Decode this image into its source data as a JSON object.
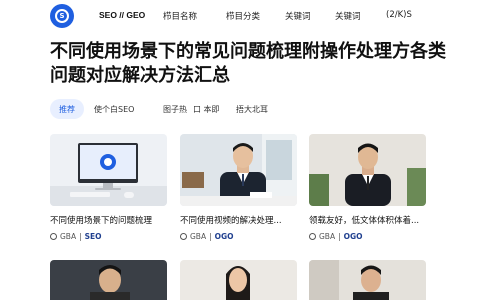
{
  "header": {
    "brand": "SEO // GEO",
    "nav": [
      "栉目名称",
      "栉目分类",
      "关键词",
      "关键词",
      "(2/K)S"
    ]
  },
  "page_title": "不同使用场景下的常见问题梳理附操作处理方各类问题对应解决方法汇总",
  "tabs": [
    "推荐",
    "使个白SEO",
    "图子热",
    "口 本即",
    "捂大北耳"
  ],
  "cards": [
    {
      "title": "不同使用场景下的问题梳理",
      "source": "GBA",
      "tag": "SEO"
    },
    {
      "title": "不同使用视频的解决处理...",
      "source": "GBA",
      "tag": "OGO"
    },
    {
      "title": "领载友好，低文体体积体着...",
      "source": "GBA",
      "tag": "OGO"
    }
  ],
  "colors": {
    "accent": "#1f5fe0",
    "tab_active_bg": "#e8efff"
  }
}
